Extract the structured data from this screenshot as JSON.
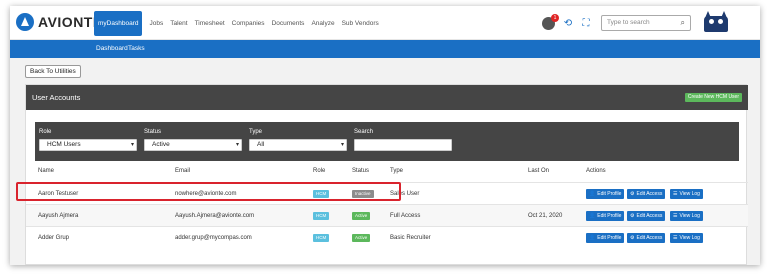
{
  "logo": {
    "text": "AVIONTÉ"
  },
  "nav": {
    "items": [
      "myDashboard",
      "Jobs",
      "Talent",
      "Timesheet",
      "Companies",
      "Documents",
      "Analyze",
      "Sub Vendors"
    ],
    "active": "myDashboard"
  },
  "header": {
    "notification_count": "1",
    "search_placeholder": "Type to search"
  },
  "subnav": {
    "items": [
      "Dashboard",
      "Tasks"
    ]
  },
  "back_button": "Back To Utilities",
  "panel": {
    "title": "User Accounts",
    "create_button": "Create New HCM User"
  },
  "filters": {
    "role_label": "Role",
    "role_value": "HCM Users",
    "status_label": "Status",
    "status_value": "Active",
    "type_label": "Type",
    "type_value": "All",
    "search_label": "Search",
    "search_value": ""
  },
  "table": {
    "columns": [
      "Name",
      "Email",
      "Role",
      "Status",
      "Type",
      "Last On",
      "Actions"
    ],
    "rows": [
      {
        "name": "Aaron Testuser",
        "email": "nowhere@avionte.com",
        "role": "HCM",
        "status": "Inactive",
        "type": "Sales User",
        "last_on": ""
      },
      {
        "name": "Aayush Ajmera",
        "email": "Aayush.Ajmera@avionte.com",
        "role": "HCM",
        "status": "Active",
        "type": "Full Access",
        "last_on": "Oct 21, 2020"
      },
      {
        "name": "Adder Grup",
        "email": "adder.grup@mycompas.com",
        "role": "HCM",
        "status": "Active",
        "type": "Basic Recruiter",
        "last_on": ""
      }
    ],
    "actions": [
      "Edit Profile",
      "Edit Access",
      "View Log"
    ]
  },
  "colors": {
    "brand_blue": "#1a6fc4",
    "panel_dark": "#454545",
    "active_green": "#5cb85c",
    "role_teal": "#5bc0de",
    "inactive_gray": "#8c8c8c",
    "highlight_red": "#d9232d"
  }
}
